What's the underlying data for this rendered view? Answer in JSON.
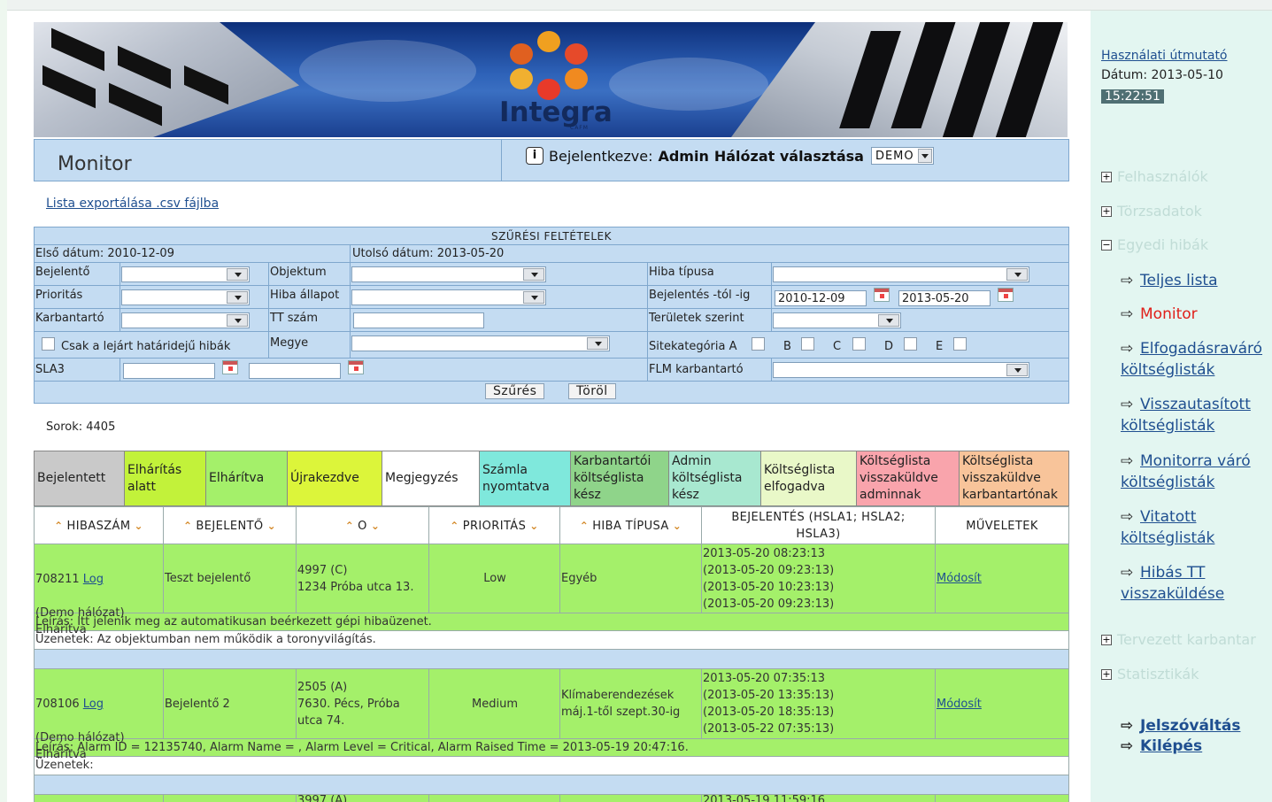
{
  "header": {
    "title": "Monitor",
    "login_label": "Bejelentkezve:",
    "login_user": "Admin",
    "network_label": "Hálózat választása",
    "network_value": "DEMO",
    "logo_text": "Integra",
    "logo_sub": "CAFM"
  },
  "export_link": "Lista exportálása .csv fájlba",
  "filter": {
    "title": "SZŰRÉSI FELTÉTELEK",
    "first_date": "Első dátum: 2010-12-09",
    "last_date": "Utolsó dátum: 2013-05-20",
    "labels": {
      "reporter": "Bejelentő",
      "object": "Objektum",
      "fault_type": "Hiba típusa",
      "priority": "Prioritás",
      "fault_state": "Hiba állapot",
      "report_range": "Bejelentés -tól -ig",
      "maintainer": "Karbantartó",
      "tt_number": "TT szám",
      "by_area": "Területek szerint",
      "expired_only": "Csak a lejárt határidejű hibák",
      "county": "Megye",
      "site_category": "Sitekategória A",
      "sla3": "SLA3",
      "flm_maintainer": "FLM karbantartó"
    },
    "site_cats": [
      "B",
      "C",
      "D",
      "E"
    ],
    "date_from": "2010-12-09",
    "date_to": "2013-05-20",
    "filter_button": "Szűrés",
    "clear_button": "Töröl"
  },
  "rows_count": "Sorok: 4405",
  "legend": [
    {
      "label": "Bejelentett",
      "color": "#c9c9c9"
    },
    {
      "label": "Elhárítás alatt",
      "color": "#c2f23a"
    },
    {
      "label": "Elhárítva",
      "color": "#a4f06a"
    },
    {
      "label": "Újrakezdve",
      "color": "#dcf53a"
    },
    {
      "label": "Megjegyzés",
      "color": "#ffffff"
    },
    {
      "label": "Számla nyomtatva",
      "color": "#7fe8dc"
    },
    {
      "label": "Karbantartói költséglista kész",
      "color": "#8fd48a"
    },
    {
      "label": "Admin költséglista kész",
      "color": "#a8e8d0"
    },
    {
      "label": "Költséglista elfogadva",
      "color": "#e9f8c8"
    },
    {
      "label": "Költséglista visszaküldve adminnak",
      "color": "#f9a4ac"
    },
    {
      "label": "Költséglista visszaküldve karbantartónak",
      "color": "#f8c49a"
    }
  ],
  "columns": [
    "HIBASZÁM",
    "BEJELENTŐ",
    "O",
    "PRIORITÁS",
    "HIBA TÍPUSA",
    "BEJELENTÉS (HSLA1; HSLA2; HSLA3)",
    "MŰVELETEK"
  ],
  "records": [
    {
      "id": "708211",
      "log": "Log",
      "network": "(Demo hálózat)",
      "state": "Elhárítva",
      "reporter": "Teszt bejelentő",
      "object": "4997 (C)\n1234 Próba utca 13.",
      "priority": "Low",
      "type": "Egyéb",
      "times": "2013-05-20 08:23:13\n(2013-05-20 09:23:13)\n(2013-05-20 10:23:13)\n(2013-05-20 09:23:13)",
      "action": "Módosít",
      "desc": "Leírás: Itt jelenik meg az automatikusan beérkezett gépi hibaüzenet.",
      "msg": "Üzenetek: Az objektumban nem működik a toronyvilágítás."
    },
    {
      "id": "708106",
      "log": "Log",
      "network": "(Demo hálózat)",
      "state": "Elhárítva",
      "reporter": "Bejelentő 2",
      "object": "2505 (A)\n7630. Pécs, Próba\nutca 74.",
      "priority": "Medium",
      "type": "Klímaberendezések\nmáj.1-től szept.30-ig",
      "times": "2013-05-20 07:35:13\n(2013-05-20 13:35:13)\n(2013-05-20 18:35:13)\n(2013-05-22 07:35:13)",
      "action": "Módosít",
      "desc": "Leírás: Alarm ID = 12135740, Alarm Name = , Alarm Level = Critical, Alarm Raised Time = 2013-05-19 20:47:16.",
      "msg": "Üzenetek:"
    }
  ],
  "partial_row": {
    "object": "3997 (A)",
    "times": "2013-05-19 11:59:16"
  },
  "side": {
    "manual": "Használati útmutató",
    "date": "Dátum: 2013-05-10",
    "time": "15:22:51",
    "nav": [
      {
        "label": "Felhasználók",
        "sign": "+"
      },
      {
        "label": "Törzsadatok",
        "sign": "+"
      },
      {
        "label": "Egyedi hibák",
        "sign": "−"
      }
    ],
    "sub": [
      "Teljes lista",
      "Monitor",
      "Elfogadásraváró költséglisták",
      "Visszautasított költséglisták",
      "Monitorra váró költséglisták",
      "Vitatott költséglisták",
      "Hibás TT visszaküldése"
    ],
    "nav2": [
      {
        "label": "Tervezett karbantar",
        "sign": "+"
      },
      {
        "label": "Statisztikák",
        "sign": "+"
      }
    ],
    "bottom": [
      "Jelszóváltás",
      "Kilépés"
    ]
  }
}
